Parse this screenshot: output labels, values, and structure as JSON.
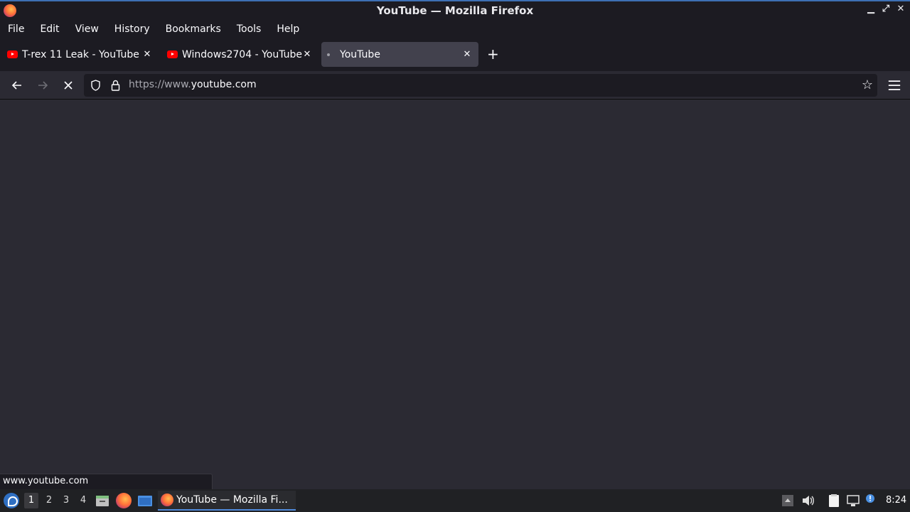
{
  "window": {
    "title": "YouTube — Mozilla Firefox"
  },
  "menubar": {
    "items": [
      {
        "label": "File"
      },
      {
        "label": "Edit"
      },
      {
        "label": "View"
      },
      {
        "label": "History"
      },
      {
        "label": "Bookmarks"
      },
      {
        "label": "Tools"
      },
      {
        "label": "Help"
      }
    ]
  },
  "tabs": [
    {
      "label": "T-rex 11 Leak - YouTube",
      "favicon": "youtube-icon",
      "selected": false
    },
    {
      "label": "Windows2704 - YouTube",
      "favicon": "youtube-icon",
      "selected": false
    },
    {
      "label": "YouTube",
      "favicon": "loading-dot-icon",
      "selected": true
    }
  ],
  "navbar": {
    "url_prefix": "https://www.",
    "url_domain": "youtube.com"
  },
  "status": {
    "text": "www.youtube.com"
  },
  "taskbar": {
    "workspaces": [
      "1",
      "2",
      "3",
      "4"
    ],
    "active_workspace": "1",
    "task_label": "YouTube — Mozilla Fi...",
    "clock": "8:24"
  },
  "colors": {
    "chrome_dark": "#1c1b22",
    "toolbar": "#2b2a33",
    "selected_tab": "#42414d",
    "accent": "#4f8bdc",
    "youtube_red": "#ff0000"
  }
}
